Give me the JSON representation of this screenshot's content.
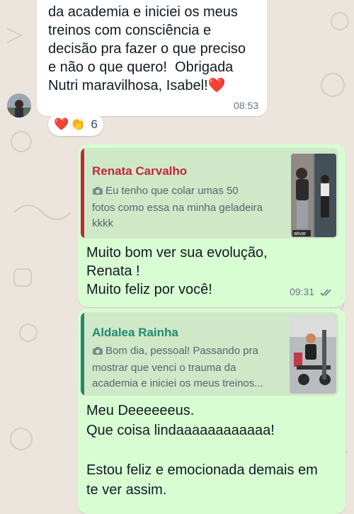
{
  "messages": [
    {
      "text": "da academia e iniciei os meus\ntreinos com consciência e\ndecisão pra fazer o que preciso\ne não o que quero!  Obrigada\nNutri maravilhosa, Isabel!",
      "heart_emoji": "❤️",
      "time": "08:53",
      "reactions": {
        "emoji_1": "❤️",
        "emoji_2": "👏",
        "count": "6"
      }
    },
    {
      "quote": {
        "author": "Renata Carvalho",
        "author_color": "#c0283a",
        "camera_icon": "camera-icon",
        "text": "Eu tenho que colar umas 50\nfotos como essa na minha geladeira\nkkkk",
        "thumb_label": "ativar"
      },
      "text": "Muito bom ver sua evolução,\nRenata !\nMuito feliz por você!",
      "time": "09:31"
    },
    {
      "quote": {
        "author": "Aldalea Rainha",
        "author_color": "#1f8a70",
        "camera_icon": "camera-icon",
        "text": "Bom dia, pessoal! Passando pra\nmostrar que venci o trauma da\nacademia e iniciei os meus treinos..."
      },
      "text": "Meu Deeeeeeus.\nQue coisa lindaaaaaaaaaaaa!\n\nEstou feliz e emocionada demais em\nte ver assim."
    }
  ],
  "colors": {
    "chat_background": "#ece5dd",
    "outgoing_bubble": "#d9fdd3",
    "incoming_bubble": "#ffffff",
    "read_ticks": "#667781"
  }
}
